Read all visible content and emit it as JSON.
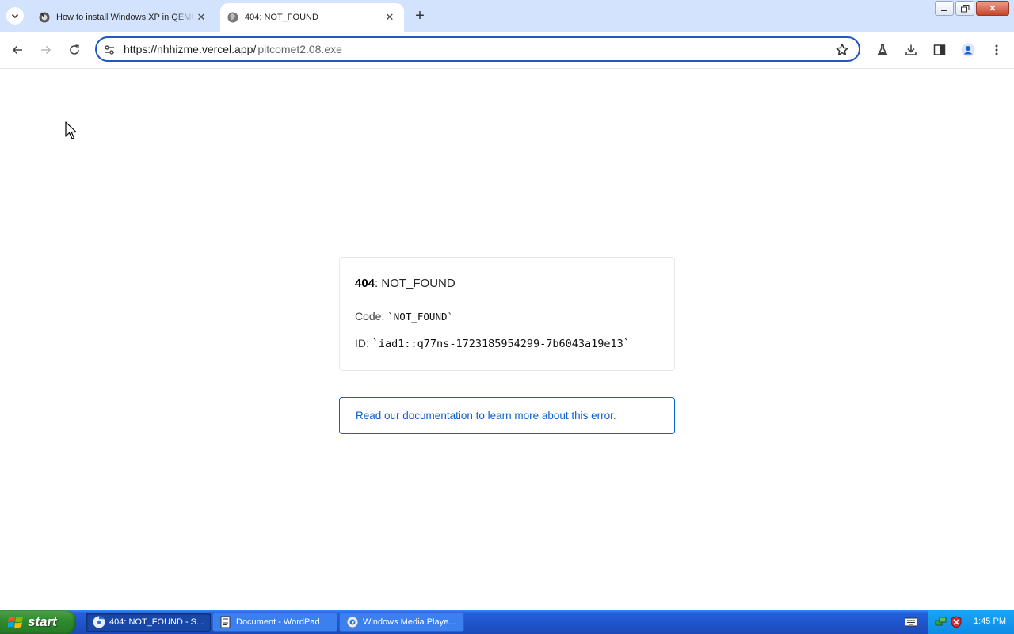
{
  "browser": {
    "tabs": [
      {
        "title": "How to install Windows XP in QEMU",
        "active": false
      },
      {
        "title": "404: NOT_FOUND",
        "active": true
      }
    ],
    "address": {
      "host": "https://nhhizme.vercel.app/",
      "path": "pitcomet2.08.exe"
    }
  },
  "error": {
    "status": "404",
    "status_text": ": NOT_FOUND",
    "code_label": "Code:",
    "code_value": "`NOT_FOUND`",
    "id_label": "ID:",
    "id_value": "`iad1::q77ns-1723185954299-7b6043a19e13`",
    "doc_link": "Read our documentation to learn more about this error."
  },
  "taskbar": {
    "start_label": "start",
    "tasks": [
      {
        "label": "404: NOT_FOUND - S...",
        "active": true,
        "icon": "chrome-icon"
      },
      {
        "label": "Document - WordPad",
        "active": false,
        "icon": "wordpad-icon"
      },
      {
        "label": "Windows Media Playe...",
        "active": false,
        "icon": "media-player-icon"
      }
    ],
    "clock": "1:45 PM"
  },
  "colors": {
    "tabstrip_bg": "#d3e3fd",
    "omnibox_focus": "#1f57c3",
    "link_blue": "#0761d1",
    "taskbar_blue": "#1f53c9",
    "start_green": "#2e8a2e"
  }
}
